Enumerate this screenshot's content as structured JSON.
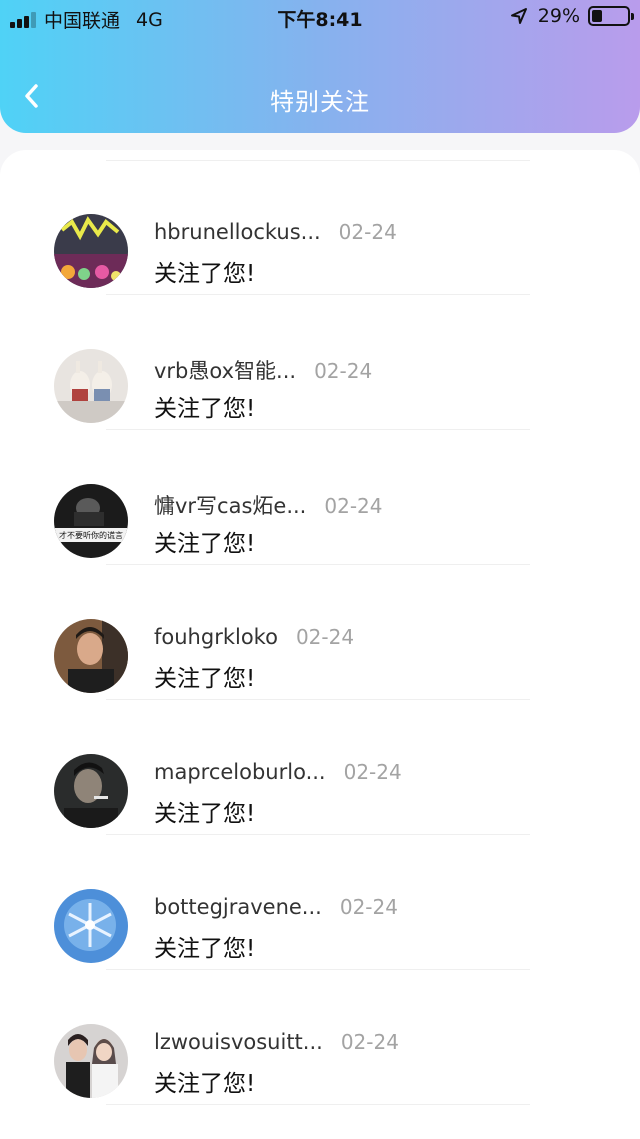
{
  "status_bar": {
    "carrier": "中国联通",
    "network": "4G",
    "time": "下午8:41",
    "battery": "29%",
    "battery_level": 0.29
  },
  "nav": {
    "title": "特别关注",
    "back_icon": "chevron-left-icon"
  },
  "colors": {
    "header_gradient_start": "#4fd2f6",
    "header_gradient_end": "#b99cec",
    "date_gray": "#a3a3a3"
  },
  "items": [
    {
      "name": "hbrunellockus...",
      "date": "02-24",
      "message": "关注了您!"
    },
    {
      "name": "vrb愚ox智能...",
      "date": "02-24",
      "message": "关注了您!"
    },
    {
      "name": "慵vr写cas炻e...",
      "date": "02-24",
      "message": "关注了您!",
      "avatar_text": "才不要听你的谎言"
    },
    {
      "name": "fouhgrkloko",
      "date": "02-24",
      "message": "关注了您!"
    },
    {
      "name": "maprceloburlo...",
      "date": "02-24",
      "message": "关注了您!"
    },
    {
      "name": "bottegjravene...",
      "date": "02-24",
      "message": "关注了您!"
    },
    {
      "name": "lzwouisvosuitt...",
      "date": "02-24",
      "message": "关注了您!"
    }
  ]
}
